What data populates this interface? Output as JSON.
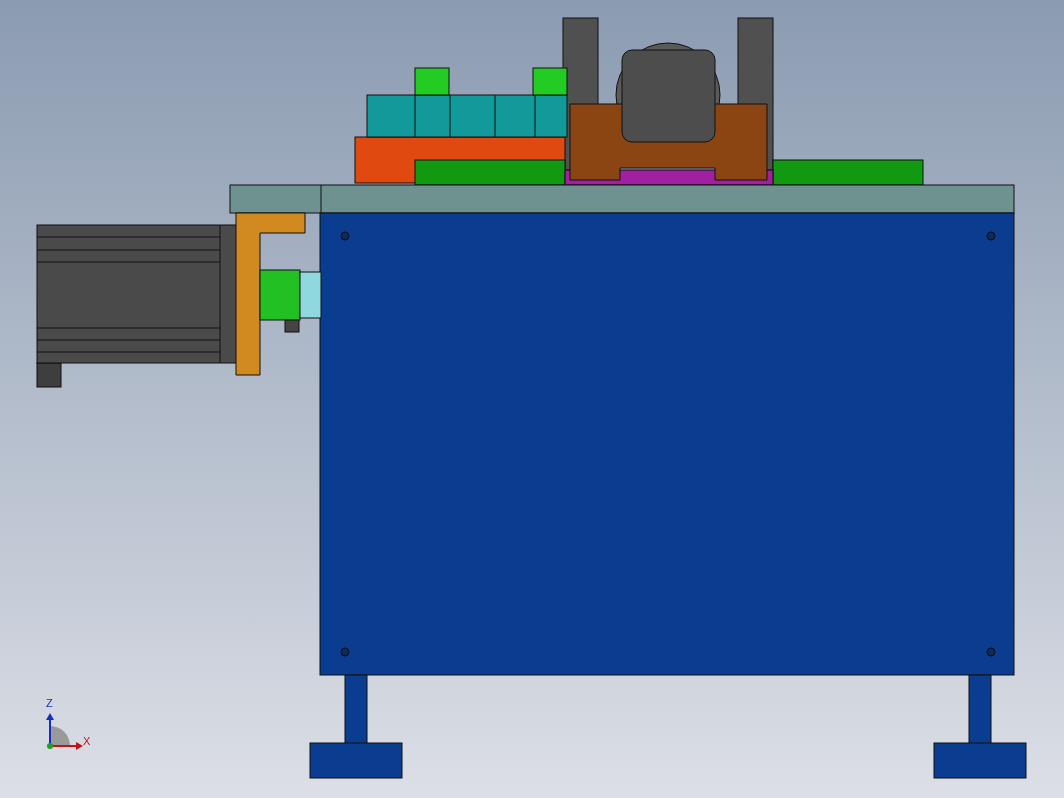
{
  "axis_triad": {
    "vertical_label": "Z",
    "horizontal_label": "X"
  }
}
